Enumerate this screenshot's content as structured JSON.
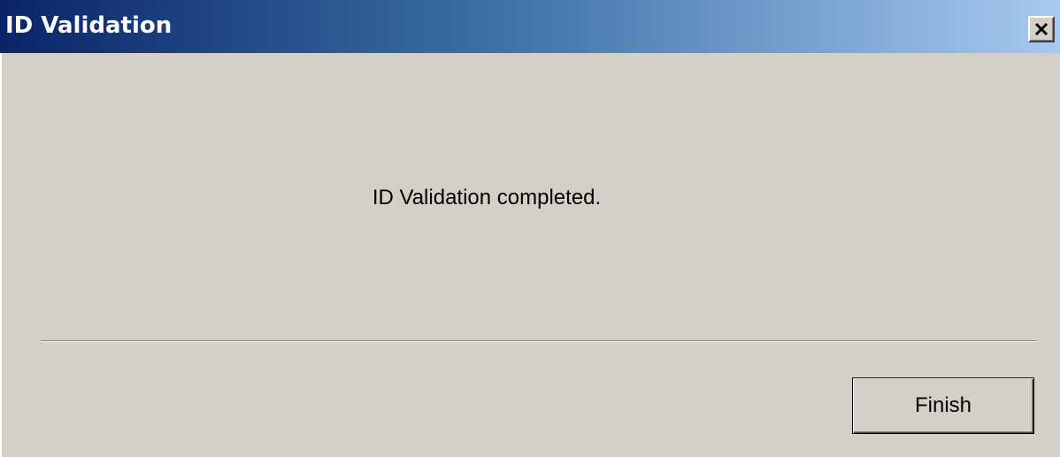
{
  "window": {
    "title": "ID Validation",
    "close_icon": "close-icon"
  },
  "content": {
    "message": "ID Validation completed."
  },
  "footer": {
    "finish_label": "Finish"
  },
  "colors": {
    "title_bar_start": "#0a246a",
    "title_bar_end": "#a6caf0",
    "dialog_background": "#d4d0c8"
  }
}
